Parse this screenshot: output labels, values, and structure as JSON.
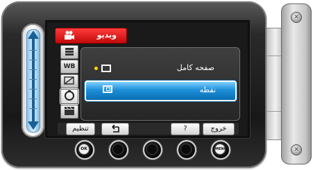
{
  "menu": {
    "title": "ويديو",
    "title_color": "#d81414",
    "options": [
      {
        "label": "صفحه کامل",
        "selected": false,
        "current": true
      },
      {
        "label": "نقطه",
        "selected": true,
        "current": false
      }
    ]
  },
  "side_icons": [
    "camera-icon",
    "stack-icon",
    "white-balance-icon",
    "scene-icon",
    "focus-icon",
    "clapper-icon"
  ],
  "side_icon_labels": {
    "wb": "WB"
  },
  "soft_buttons": {
    "settings": "تنظیم",
    "back": "⮌",
    "help": "?",
    "exit": "خروج"
  },
  "hardware_buttons": {
    "ok": "OK",
    "menu": "MENU"
  },
  "colors": {
    "highlight": "#1d8fd8",
    "indicator": "#ffd800",
    "slider": "#8ec7ee"
  }
}
